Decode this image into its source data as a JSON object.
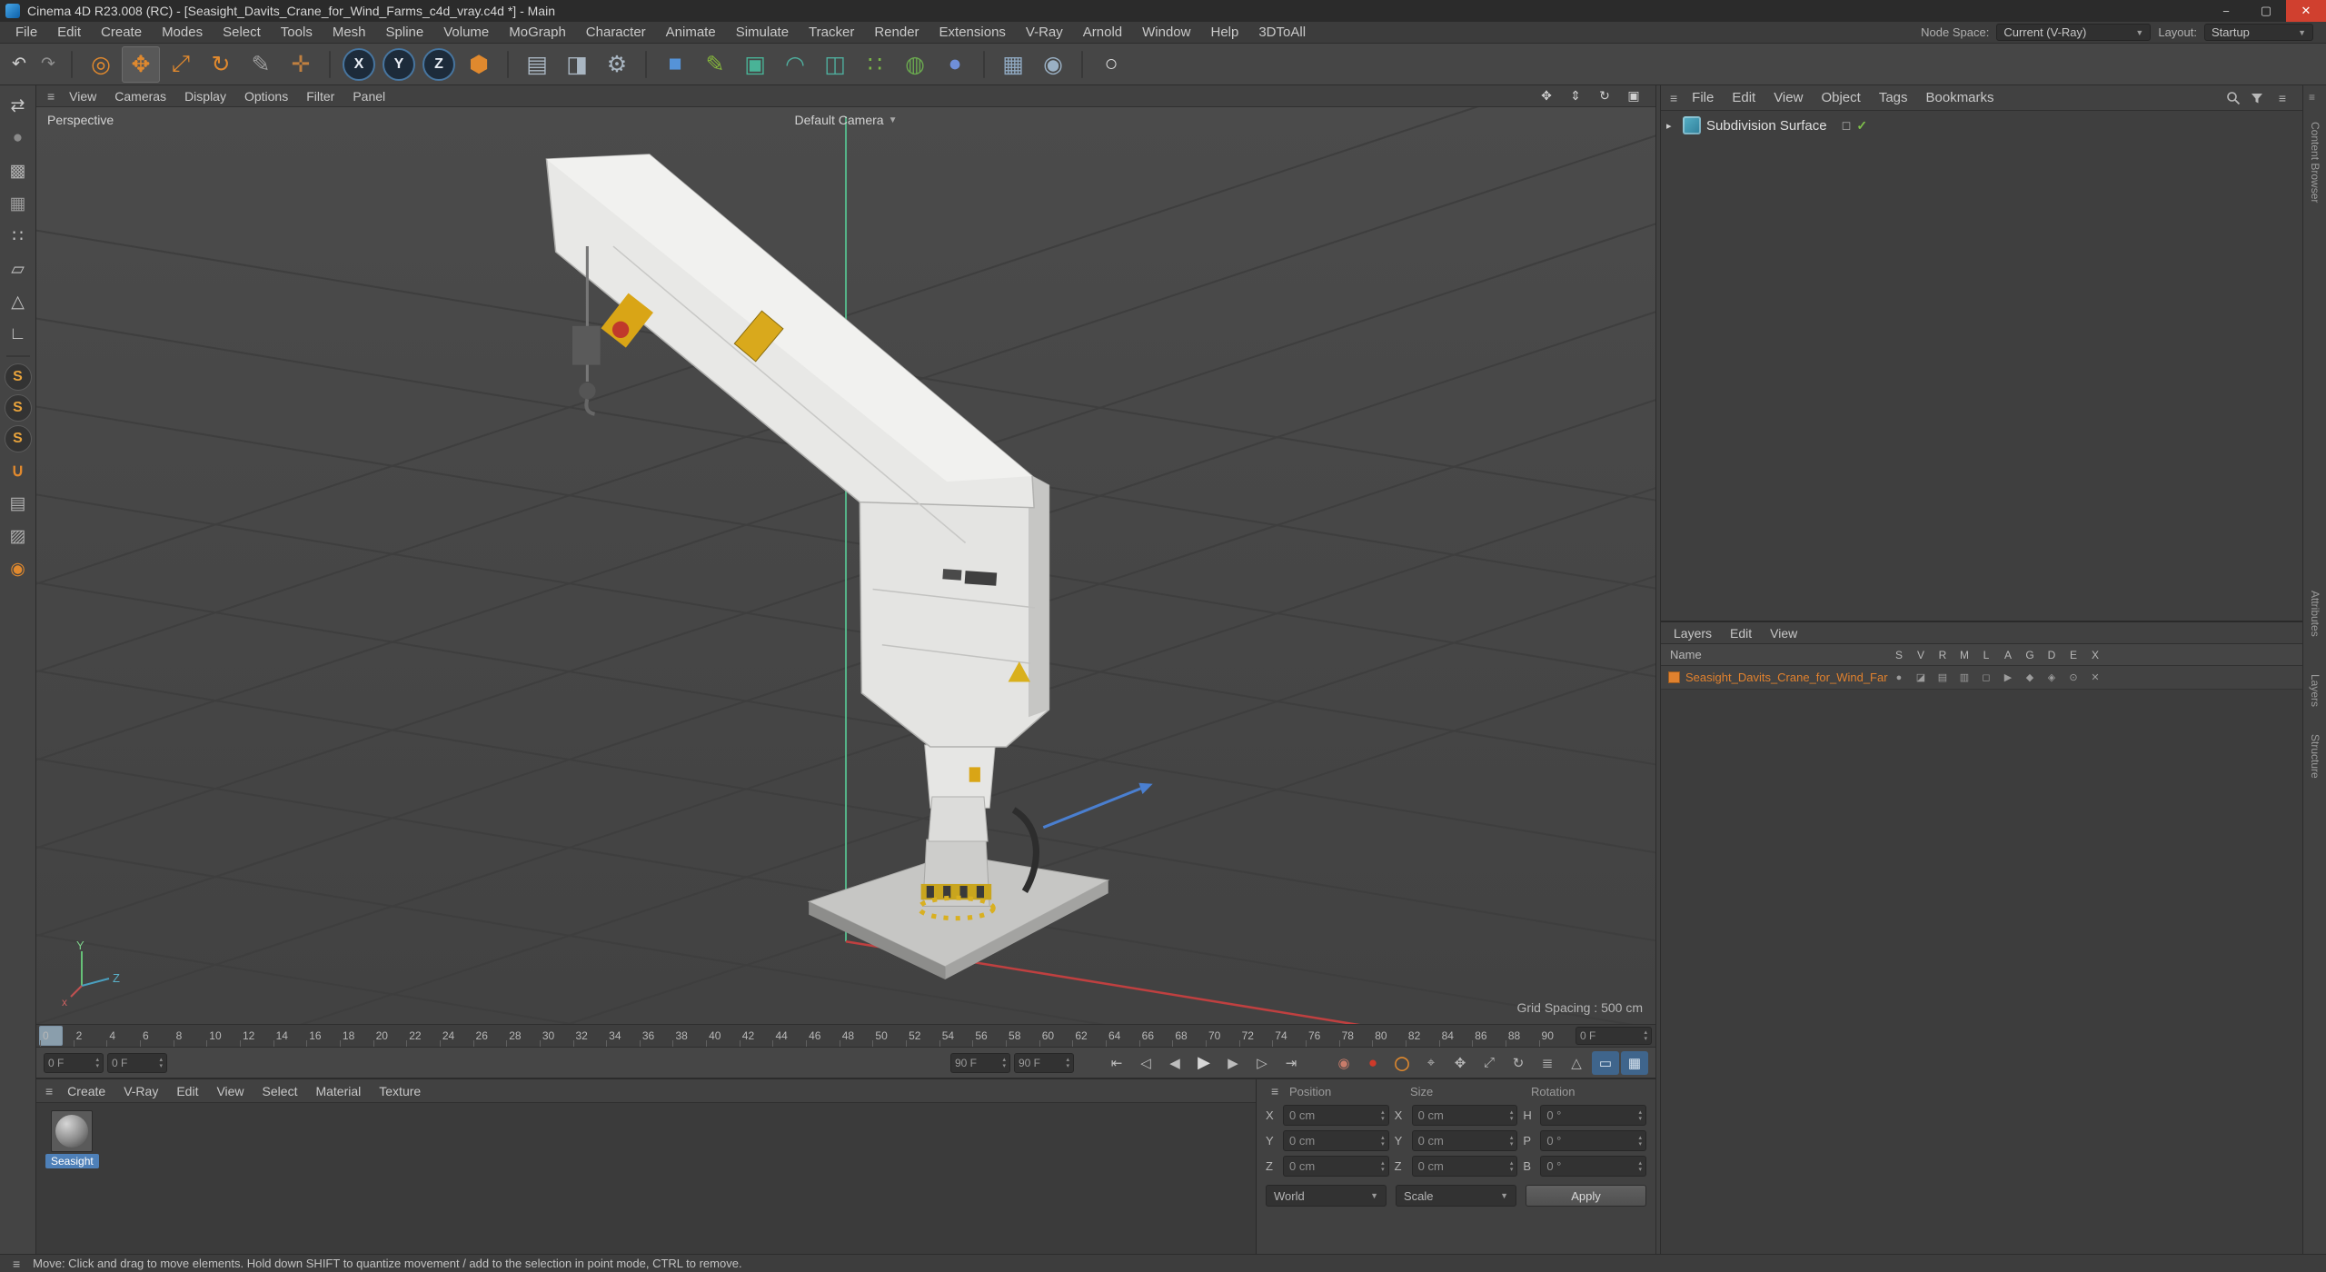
{
  "icons": {
    "burger": "≡",
    "arrow_right": "▸",
    "check": "✓",
    "box": "◻",
    "step_up": "▴",
    "step_down": "▾",
    "dd_arrow": "▼",
    "minimize": "−",
    "maximize": "▢",
    "close": "✕"
  },
  "window": {
    "title": "Cinema 4D R23.008 (RC) - [Seasight_Davits_Crane_for_Wind_Farms_c4d_vray.c4d *] - Main"
  },
  "menu_bar": {
    "items": [
      "File",
      "Edit",
      "Create",
      "Modes",
      "Select",
      "Tools",
      "Mesh",
      "Spline",
      "Volume",
      "MoGraph",
      "Character",
      "Animate",
      "Simulate",
      "Tracker",
      "Render",
      "Extensions",
      "V-Ray",
      "Arnold",
      "Window",
      "Help",
      "3DToAll"
    ],
    "node_space_label": "Node Space:",
    "node_space_value": "Current (V-Ray)",
    "layout_label": "Layout:",
    "layout_value": "Startup"
  },
  "toolbar": {
    "icons": [
      {
        "name": "undo-icon",
        "glyph": "↶",
        "cls": "tbtn sm",
        "style": "color:#d0d0d0"
      },
      {
        "name": "redo-icon",
        "glyph": "↷",
        "cls": "tbtn sm",
        "style": "color:#8e8e8e"
      },
      {
        "name": "separator",
        "glyph": "",
        "cls": "tsep",
        "inter": "false"
      },
      {
        "name": "live-selection-icon",
        "glyph": "◎",
        "style": "color:#e0892e"
      },
      {
        "name": "move-tool-icon",
        "glyph": "✥",
        "cls": "tbtn active",
        "style": "color:#e0892e"
      },
      {
        "name": "scale-tool-icon",
        "glyph": "⤢",
        "style": "color:#e0892e"
      },
      {
        "name": "rotate-tool-icon",
        "glyph": "↻",
        "style": "color:#e0892e"
      },
      {
        "name": "last-used-tool-icon",
        "glyph": "✎",
        "style": "color:#9c9c9c"
      },
      {
        "name": "tweak-mode-icon",
        "glyph": "✛",
        "style": "color:#c08040"
      },
      {
        "name": "separator",
        "glyph": "",
        "cls": "tsep",
        "inter": "false"
      },
      {
        "name": "x-axis-lock-button",
        "glyph": "X",
        "cls": "tbtn ax"
      },
      {
        "name": "y-axis-lock-button",
        "glyph": "Y",
        "cls": "tbtn ax"
      },
      {
        "name": "z-axis-lock-button",
        "glyph": "Z",
        "cls": "tbtn ax"
      },
      {
        "name": "coordinate-system-icon",
        "glyph": "⬢",
        "style": "color:#e0892e"
      },
      {
        "name": "separator",
        "glyph": "",
        "cls": "tsep",
        "inter": "false"
      },
      {
        "name": "render-view-icon",
        "glyph": "▤",
        "style": "color:#a9b6c2"
      },
      {
        "name": "render-picture-viewer-icon",
        "glyph": "◨",
        "style": "color:#a9b6c2"
      },
      {
        "name": "render-settings-icon",
        "glyph": "⚙",
        "style": "color:#a9b6c2"
      },
      {
        "name": "separator",
        "glyph": "",
        "cls": "tsep",
        "inter": "false"
      },
      {
        "name": "add-cube-icon",
        "glyph": "■",
        "style": "color:#5593d8"
      },
      {
        "name": "pen-tool-icon",
        "glyph": "✎",
        "style": "color:#84b43c"
      },
      {
        "name": "subdivision-surface-icon",
        "glyph": "▣",
        "style": "color:#49b397"
      },
      {
        "name": "bend-deformer-icon",
        "glyph": "◠",
        "style": "color:#4fae9e"
      },
      {
        "name": "instance-icon",
        "glyph": "◫",
        "style": "color:#4fae9e"
      },
      {
        "name": "cloner-icon",
        "glyph": "∷",
        "style": "color:#7ab648"
      },
      {
        "name": "field-icon",
        "glyph": "◍",
        "style": "color:#6aa84f"
      },
      {
        "name": "volume-icon",
        "glyph": "●",
        "style": "color:#6f8fd8"
      },
      {
        "name": "separator",
        "glyph": "",
        "cls": "tsep",
        "inter": "false"
      },
      {
        "name": "floor-icon",
        "glyph": "▦",
        "style": "color:#8fa8c0"
      },
      {
        "name": "camera-icon",
        "glyph": "◉",
        "style": "color:#9ab0c4"
      },
      {
        "name": "separator",
        "glyph": "",
        "cls": "tsep",
        "inter": "false"
      },
      {
        "name": "light-icon",
        "glyph": "○",
        "style": "color:#d8d8d8"
      }
    ]
  },
  "left_toolbar": {
    "icons": [
      {
        "name": "make-editable-icon",
        "glyph": "⇄",
        "style": "color:#c8c8c8"
      },
      {
        "name": "model-mode-icon",
        "glyph": "●",
        "style": "color:#8a8a8a"
      },
      {
        "name": "texture-mode-icon",
        "glyph": "▩",
        "style": "color:#b0b0b0"
      },
      {
        "name": "workplane-mode-icon",
        "glyph": "▦",
        "style": "color:#9a9a9a"
      },
      {
        "name": "points-mode-icon",
        "glyph": "∷",
        "style": "color:#c0c0c0"
      },
      {
        "name": "edges-mode-icon",
        "glyph": "▱",
        "style": "color:#c0c0c0"
      },
      {
        "name": "polygons-mode-icon",
        "glyph": "△",
        "style": "color:#c0c0c0"
      },
      {
        "name": "enable-axis-icon",
        "glyph": "∟",
        "style": "color:#c8c8c8"
      },
      {
        "name": "separator",
        "glyph": "",
        "cls": "lsep",
        "inter": "false"
      },
      {
        "name": "viewport-solo-off-icon",
        "glyph": "S",
        "cls": "ltbtn sbadge"
      },
      {
        "name": "viewport-solo-single-icon",
        "glyph": "S",
        "cls": "ltbtn sbadge"
      },
      {
        "name": "viewport-solo-hierarchy-icon",
        "glyph": "S",
        "cls": "ltbtn sbadge"
      },
      {
        "name": "enable-snap-icon",
        "glyph": "∪",
        "style": "color:#e0892e;font-weight:bold"
      },
      {
        "name": "quantize-icon",
        "glyph": "▤",
        "style": "color:#b0b0b0"
      },
      {
        "name": "workplane-snap-icon",
        "glyph": "▨",
        "style": "color:#b0b0b0"
      },
      {
        "name": "auto-workplane-icon",
        "glyph": "◉",
        "style": "color:#e0892e"
      }
    ]
  },
  "viewport": {
    "menu": [
      "View",
      "Cameras",
      "Display",
      "Options",
      "Filter",
      "Panel"
    ],
    "nav_icons": [
      {
        "name": "pan-view-icon",
        "glyph": "✥"
      },
      {
        "name": "dolly-view-icon",
        "glyph": "⇕"
      },
      {
        "name": "orbit-view-icon",
        "glyph": "↻"
      },
      {
        "name": "toggle-view-icon",
        "glyph": "▣"
      }
    ],
    "view_label": "Perspective",
    "camera_label": "Default Camera",
    "grid_spacing": "Grid Spacing : 500 cm",
    "axis_labels": {
      "x": "x",
      "y": "Y",
      "z": "Z"
    }
  },
  "ruler": {
    "ticks": [
      "0",
      "2",
      "4",
      "6",
      "8",
      "10",
      "12",
      "14",
      "16",
      "18",
      "20",
      "22",
      "24",
      "26",
      "28",
      "30",
      "32",
      "34",
      "36",
      "38",
      "40",
      "42",
      "44",
      "46",
      "48",
      "50",
      "52",
      "54",
      "56",
      "58",
      "60",
      "62",
      "64",
      "66",
      "68",
      "70",
      "72",
      "74",
      "76",
      "78",
      "80",
      "82",
      "84",
      "86",
      "88",
      "90"
    ],
    "frame_field": "0 F"
  },
  "transport": {
    "start": "0 F",
    "preview_start": "0 F",
    "preview_end": "90 F",
    "end": "90 F",
    "buttons": [
      {
        "name": "go-to-start-button",
        "glyph": "⇤"
      },
      {
        "name": "go-to-previous-key-button",
        "glyph": "◁"
      },
      {
        "name": "go-to-previous-frame-button",
        "glyph": "◀"
      },
      {
        "name": "play-button",
        "glyph": "▶",
        "style": "font-size:18px;color:#d8d8d8"
      },
      {
        "name": "go-to-next-frame-button",
        "glyph": "▶"
      },
      {
        "name": "go-to-next-key-button",
        "glyph": "▷"
      },
      {
        "name": "go-to-end-button",
        "glyph": "⇥"
      }
    ],
    "record_buttons": [
      {
        "name": "record-active-objects-icon",
        "glyph": "◉",
        "style": "color:#c87c6a"
      },
      {
        "name": "record-keyframe-icon",
        "glyph": "●",
        "style": "color:#cf3a2a;font-size:17px"
      },
      {
        "name": "autokeying-icon",
        "glyph": "◯",
        "style": "color:#e0892e;font-weight:bold"
      },
      {
        "name": "keyframe-selection-icon",
        "glyph": "⌖",
        "style": "color:#b8b8b8"
      },
      {
        "name": "record-position-icon",
        "glyph": "✥",
        "style": "color:#b8b8b8"
      },
      {
        "name": "record-scale-icon",
        "glyph": "⤢",
        "style": "color:#b8b8b8"
      },
      {
        "name": "record-rotation-icon",
        "glyph": "↻",
        "style": "color:#b8b8b8"
      },
      {
        "name": "record-parameter-icon",
        "glyph": "≣",
        "style": "color:#b8b8b8"
      },
      {
        "name": "record-pla-icon",
        "glyph": "△",
        "style": "color:#b8b8b8"
      },
      {
        "name": "solo-animation-icon",
        "glyph": "▭",
        "cls": "trbtn on"
      },
      {
        "name": "animation-palette-icon",
        "glyph": "▦",
        "cls": "trbtn on"
      }
    ]
  },
  "object_manager": {
    "menu": [
      "File",
      "Edit",
      "View",
      "Object",
      "Tags",
      "Bookmarks"
    ],
    "objects": [
      {
        "name": "Subdivision Surface"
      }
    ]
  },
  "layers": {
    "menu": [
      "Layers",
      "Edit",
      "View"
    ],
    "name_header": "Name",
    "columns": [
      "S",
      "V",
      "R",
      "M",
      "L",
      "A",
      "G",
      "D",
      "E",
      "X"
    ],
    "row": {
      "name": "Seasight_Davits_Crane_for_Wind_Farms",
      "color": "#e0812e",
      "icons": [
        "●",
        "◪",
        "▤",
        "▥",
        "◻",
        "▶",
        "◆",
        "◈",
        "⊙",
        "✕"
      ]
    }
  },
  "materials": {
    "menu": [
      "Create",
      "V-Ray",
      "Edit",
      "View",
      "Select",
      "Material",
      "Texture"
    ],
    "items": [
      {
        "name": "Seasight"
      }
    ]
  },
  "coordinates": {
    "headers": [
      "Position",
      "Size",
      "Rotation"
    ],
    "rows": [
      {
        "l1": "X",
        "v1": "0 cm",
        "l2": "X",
        "v2": "0 cm",
        "l3": "H",
        "v3": "0 °"
      },
      {
        "l1": "Y",
        "v1": "0 cm",
        "l2": "Y",
        "v2": "0 cm",
        "l3": "P",
        "v3": "0 °"
      },
      {
        "l1": "Z",
        "v1": "0 cm",
        "l2": "Z",
        "v2": "0 cm",
        "l3": "B",
        "v3": "0 °"
      }
    ],
    "world": "World",
    "scale": "Scale",
    "apply": "Apply"
  },
  "status_bar": {
    "text": "Move: Click and drag to move elements. Hold down SHIFT to quantize movement / add to the selection in point mode, CTRL to remove."
  },
  "side_tabs": [
    {
      "label": "Content Browser",
      "style": "top:40px"
    },
    {
      "label": "Attributes",
      "style": "top:556px"
    },
    {
      "label": "Layers",
      "style": "top:648px"
    },
    {
      "label": "Structure",
      "style": "top:714px"
    }
  ]
}
